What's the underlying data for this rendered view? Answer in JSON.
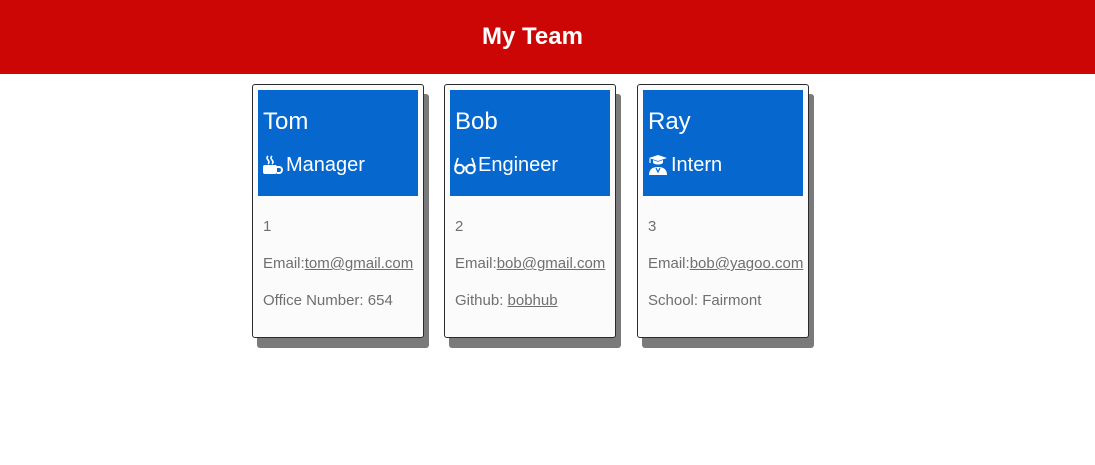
{
  "header": {
    "title": "My Team"
  },
  "cards": [
    {
      "name": "Tom",
      "role": "Manager",
      "role_icon": "coffee-mug-icon",
      "id": "1",
      "email_label": "Email:",
      "email": "tom@gmail.com",
      "extra_label": "Office Number: ",
      "extra_value": "654"
    },
    {
      "name": "Bob",
      "role": "Engineer",
      "role_icon": "glasses-icon",
      "id": "2",
      "email_label": "Email:",
      "email": "bob@gmail.com",
      "extra_label": "Github: ",
      "extra_value": "bobhub"
    },
    {
      "name": "Ray",
      "role": "Intern",
      "role_icon": "graduate-icon",
      "id": "3",
      "email_label": "Email:",
      "email": "bob@yagoo.com",
      "extra_label": "School: ",
      "extra_value": "Fairmont"
    }
  ],
  "colors": {
    "header_bg": "#cc0505",
    "card_head_bg": "#0667cf",
    "card_bg": "#fbfbfb",
    "shadow": "#7a7a7a"
  }
}
